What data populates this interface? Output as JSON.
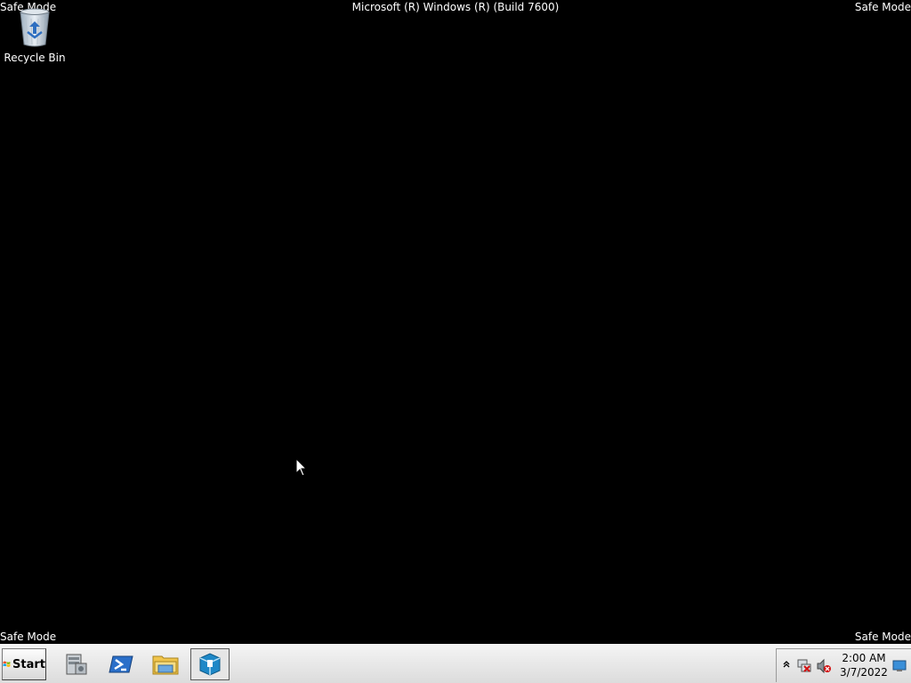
{
  "overlay": {
    "safe_mode_top_left": "Safe Mode",
    "safe_mode_top_right": "Safe Mode",
    "safe_mode_bottom_left": "Safe Mode",
    "safe_mode_bottom_right": "Safe Mode",
    "build_text": "Microsoft (R) Windows (R) (Build 7600)"
  },
  "desktop": {
    "icons": [
      {
        "label": "Recycle Bin",
        "icon": "recycle-bin-icon"
      }
    ]
  },
  "taskbar": {
    "start_label": "Start",
    "pinned": [
      {
        "icon": "server-manager-icon"
      },
      {
        "icon": "powershell-icon"
      },
      {
        "icon": "windows-explorer-icon"
      },
      {
        "icon": "app-box-icon",
        "active": true
      }
    ],
    "tray": {
      "time": "2:00 AM",
      "date": "3/7/2022",
      "icons": [
        "show-hidden-icons-chevron",
        "network-disconnected-icon",
        "volume-muted-icon",
        "show-desktop-icon"
      ]
    }
  },
  "colors": {
    "desktop_background": "#000000",
    "taskbar_background": "#e8e8e8",
    "overlay_text": "#ffffff"
  }
}
